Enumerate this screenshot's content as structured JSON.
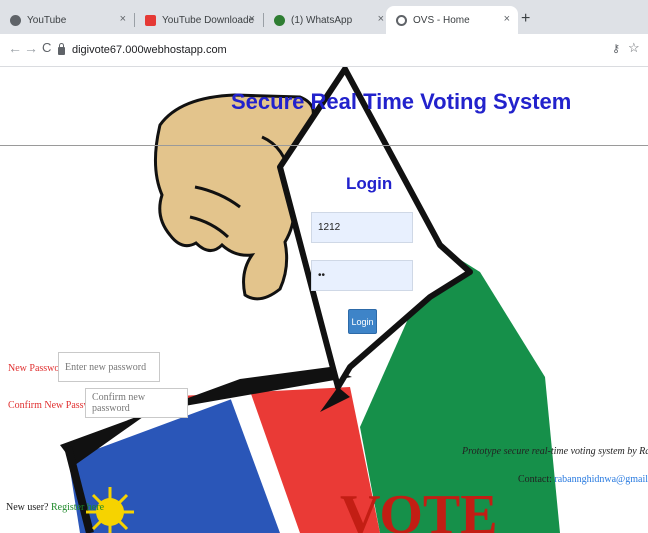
{
  "browser": {
    "tabs": [
      {
        "title": "YouTube",
        "favicon_color": "#5f6368"
      },
      {
        "title": "YouTube Downloader - Downloa",
        "favicon_color": "#e53935"
      },
      {
        "title": "(1) WhatsApp",
        "favicon_color": "#2e7d32"
      },
      {
        "title": "OVS - Home",
        "favicon_color": "#5f6368"
      }
    ],
    "close_glyph": "×",
    "new_tab_glyph": "+",
    "nav": {
      "back": "←",
      "forward": "→",
      "reload": "C"
    },
    "url": "digivote67.000webhostapp.com",
    "key_icon_glyph": "⚷",
    "star_glyph": "☆"
  },
  "site": {
    "title": "Secure Real Time Voting System"
  },
  "login": {
    "heading": "Login",
    "username_value": "1212",
    "password_value": "••",
    "button_label": "Login"
  },
  "reset": {
    "new_password_label": "New Password:",
    "new_password_placeholder": "Enter new password",
    "confirm_label": "Confirm New Password:",
    "confirm_placeholder": "Confirm new password"
  },
  "footer": {
    "prototype_text": "Prototype secure real-time voting system by Rahu",
    "contact_label": "Contact:",
    "contact_email": "rabannghidnwa@gmail.com",
    "new_user_text": "New user?",
    "register_link": "Register here"
  },
  "colors": {
    "title_blue": "#2222cc",
    "label_red": "#e03030",
    "button_blue": "#3e84c8"
  }
}
